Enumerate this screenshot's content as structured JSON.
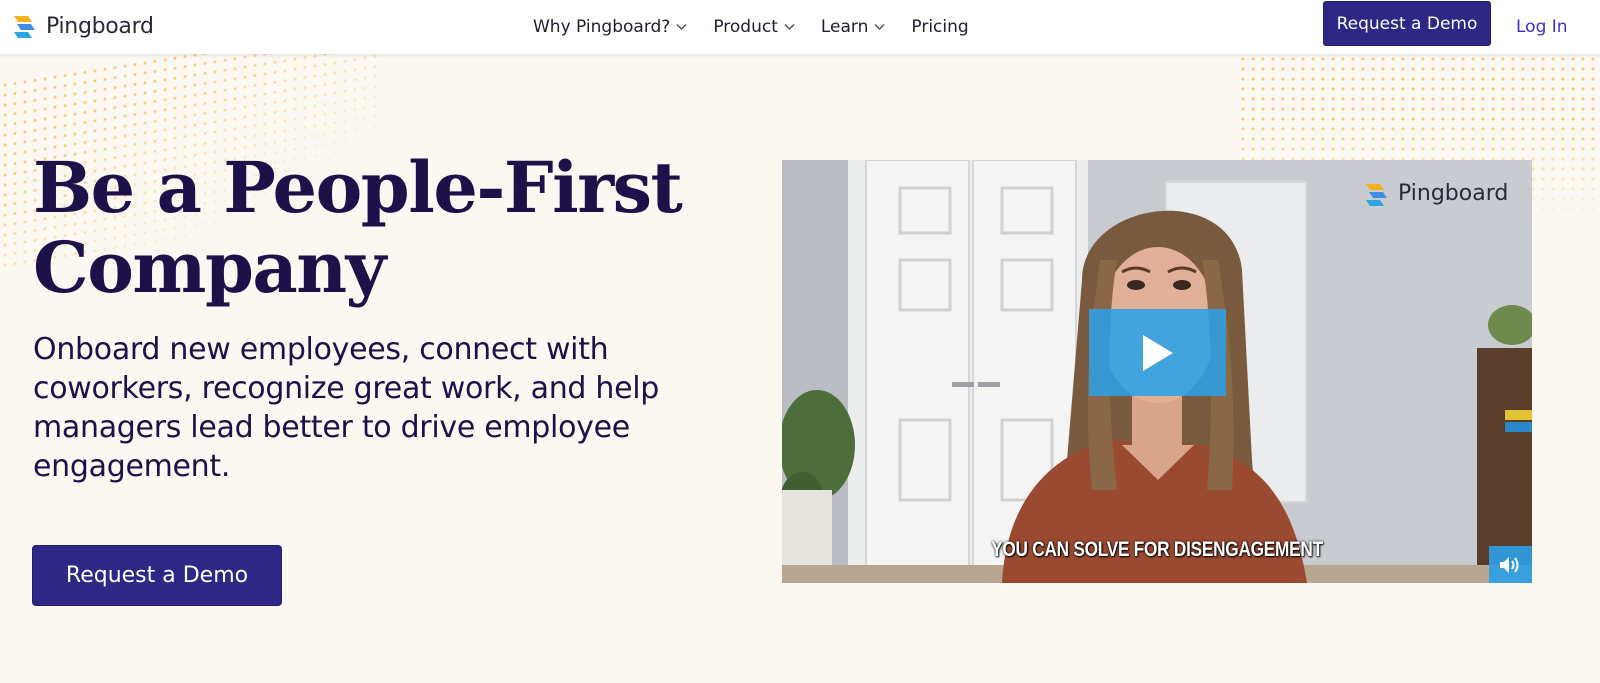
{
  "header": {
    "brand": "Pingboard",
    "nav": [
      {
        "label": "Why Pingboard?",
        "has_dropdown": true
      },
      {
        "label": "Product",
        "has_dropdown": true
      },
      {
        "label": "Learn",
        "has_dropdown": true
      },
      {
        "label": "Pricing",
        "has_dropdown": false
      }
    ],
    "demo_button": "Request a Demo",
    "login": "Log In"
  },
  "hero": {
    "title_line1": "Be a People-First",
    "title_line2": "Company",
    "subtitle": "Onboard new employees, connect with coworkers, recognize great work, and help managers lead better to drive employee engagement.",
    "demo_button": "Request a Demo"
  },
  "video": {
    "brand": "Pingboard",
    "caption": "YOU CAN SOLVE FOR DISENGAGEMENT",
    "play_icon": "play-icon",
    "volume_icon": "volume-icon"
  },
  "colors": {
    "primary": "#2e2786",
    "heading": "#1c1148",
    "link": "#3b2fc9",
    "background": "#fbf8f2",
    "accent_dots": "#f6cc7c",
    "video_control": "#2ca0e6"
  }
}
